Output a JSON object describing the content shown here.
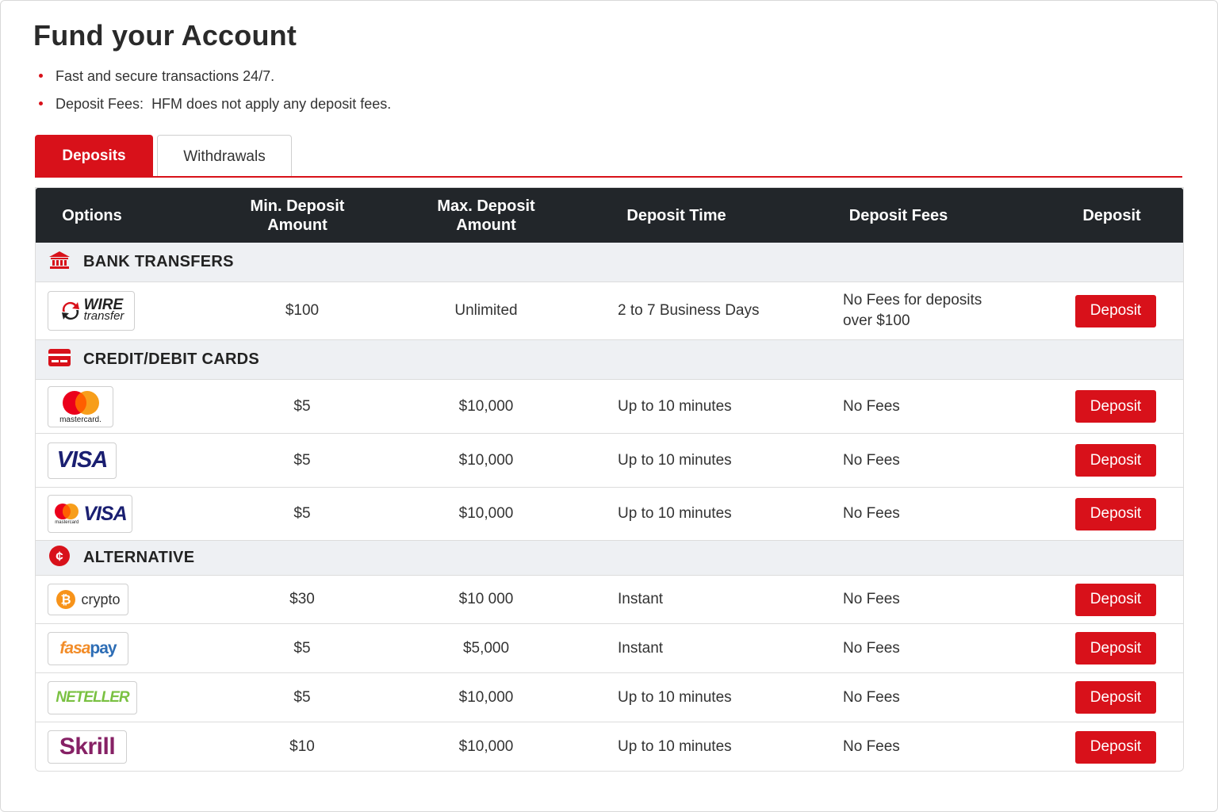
{
  "page": {
    "title": "Fund your Account",
    "bullets": {
      "first": "Fast and secure transactions 24/7.",
      "fees_label": "Deposit Fees:",
      "fees_text": "HFM does not apply any deposit fees."
    }
  },
  "tabs": [
    {
      "label": "Deposits",
      "active": true
    },
    {
      "label": "Withdrawals",
      "active": false
    }
  ],
  "table": {
    "headers": {
      "options": "Options",
      "min_deposit_line1": "Min. Deposit",
      "min_deposit_line2": "Amount",
      "max_deposit_line1": "Max. Deposit",
      "max_deposit_line2": "Amount",
      "deposit_time": "Deposit Time",
      "deposit_fees": "Deposit Fees",
      "deposit": "Deposit"
    },
    "sections": [
      {
        "title": "BANK TRANSFERS",
        "icon": "bank-icon",
        "rows": [
          {
            "method": "wire-transfer",
            "logo_text_1": "WIRE",
            "logo_text_2": "transfer",
            "min": "$100",
            "max": "Unlimited",
            "time": "2 to 7 Business Days",
            "fees_line1": "No Fees for deposits",
            "fees_line2": "over $100",
            "button": "Deposit"
          }
        ]
      },
      {
        "title": "CREDIT/DEBIT CARDS",
        "icon": "credit-card-icon",
        "rows": [
          {
            "method": "mastercard",
            "logo_text": "mastercard.",
            "min": "$5",
            "max": "$10,000",
            "time": "Up to 10 minutes",
            "fees": "No Fees",
            "button": "Deposit"
          },
          {
            "method": "visa",
            "logo_text": "VISA",
            "min": "$5",
            "max": "$10,000",
            "time": "Up to 10 minutes",
            "fees": "No Fees",
            "button": "Deposit"
          },
          {
            "method": "mastercard-visa",
            "logo_text_small": "mastercard",
            "logo_text": "VISA",
            "min": "$5",
            "max": "$10,000",
            "time": "Up to 10 minutes",
            "fees": "No Fees",
            "button": "Deposit"
          }
        ]
      },
      {
        "title": "ALTERNATIVE",
        "icon": "alternative-currency-icon",
        "rows": [
          {
            "method": "crypto",
            "logo_text": "crypto",
            "min": "$30",
            "max": "$10 000",
            "time": "Instant",
            "fees": "No Fees",
            "button": "Deposit"
          },
          {
            "method": "fasapay",
            "logo_text_1": "fasa",
            "logo_text_2": "pay",
            "min": "$5",
            "max": "$5,000",
            "time": "Instant",
            "fees": "No Fees",
            "button": "Deposit"
          },
          {
            "method": "neteller",
            "logo_text": "NETELLER",
            "min": "$5",
            "max": "$10,000",
            "time": "Up to 10 minutes",
            "fees": "No Fees",
            "button": "Deposit"
          },
          {
            "method": "skrill",
            "logo_text": "Skrill",
            "min": "$10",
            "max": "$10,000",
            "time": "Up to 10 minutes",
            "fees": "No Fees",
            "button": "Deposit"
          }
        ]
      }
    ]
  },
  "colors": {
    "brand_red": "#d8111a",
    "header_dark": "#22262a",
    "section_bg": "#eef0f3",
    "visa_blue": "#1a1f71",
    "neteller_green": "#7ac142",
    "skrill_purple": "#862165",
    "bitcoin_orange": "#f7931a",
    "fasapay_orange": "#f28c28",
    "fasapay_blue": "#2d6db5"
  }
}
